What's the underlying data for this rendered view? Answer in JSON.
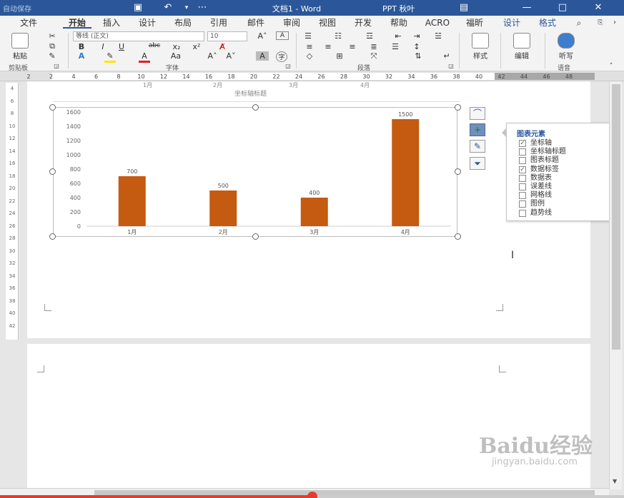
{
  "titlebar": {
    "autosave": "自动保存",
    "doc_title": "文档1  -  Word",
    "ppt_label": "PPT 秋叶",
    "buttons": {
      "minimize": "—",
      "restore": "□",
      "close": "✕"
    },
    "icons": {
      "save": "save-icon",
      "undo": "undo-icon",
      "customize": "customize-qat-icon"
    }
  },
  "tabs": [
    {
      "label": "文件"
    },
    {
      "label": "开始"
    },
    {
      "label": "插入"
    },
    {
      "label": "设计"
    },
    {
      "label": "布局"
    },
    {
      "label": "引用"
    },
    {
      "label": "邮件"
    },
    {
      "label": "审阅"
    },
    {
      "label": "视图"
    },
    {
      "label": "开发"
    },
    {
      "label": "帮助"
    },
    {
      "label": "ACRO"
    },
    {
      "label": "福昕"
    },
    {
      "label": "设计"
    },
    {
      "label": "格式"
    }
  ],
  "active_tab": "开始",
  "ribbon": {
    "paste_label": "粘贴",
    "clipboard_group": "剪贴板",
    "font_name": "等线 (正文)",
    "font_size": "10",
    "font_group": "字体",
    "paragraph_group": "段落",
    "styles_label": "样式",
    "editing_label": "编辑",
    "dictate_label": "听写",
    "voice_group": "语音",
    "format_buttons": {
      "bold": "B",
      "italic": "I",
      "underline": "U",
      "strike": "abc",
      "subscript": "x₂",
      "superscript": "x²",
      "aa": "Aa",
      "grow": "A˄",
      "shrink": "A˅"
    }
  },
  "ruler": {
    "numbers": [
      "2",
      "2",
      "4",
      "6",
      "8",
      "10",
      "12",
      "14",
      "16",
      "18",
      "20",
      "22",
      "24",
      "26",
      "28",
      "30",
      "32",
      "34",
      "36",
      "38",
      "40",
      "42",
      "44",
      "46",
      "48"
    ]
  },
  "vertical_ruler": {
    "marks": [
      "4",
      "6",
      "8",
      "10",
      "12",
      "14",
      "16",
      "18",
      "20",
      "22",
      "24",
      "26",
      "28",
      "30",
      "32",
      "34",
      "36",
      "38",
      "40",
      "42"
    ]
  },
  "previous_chart": {
    "tick_labels": [
      "1月",
      "2月",
      "3月",
      "4月"
    ],
    "axis_title": "坐标轴标题"
  },
  "chart_data": {
    "type": "bar",
    "categories": [
      "1月",
      "2月",
      "3月",
      "4月"
    ],
    "values": [
      700,
      500,
      400,
      1500
    ],
    "data_labels": [
      "700",
      "500",
      "400",
      "1500"
    ],
    "y_ticks": [
      "0",
      "200",
      "400",
      "600",
      "800",
      "1000",
      "1200",
      "1400",
      "1600"
    ],
    "ylim": [
      0,
      1600
    ],
    "title": "",
    "xlabel": "",
    "ylabel": "",
    "grid": false,
    "bar_color": "#c55a11"
  },
  "chart_tools": {
    "layout_icon": "chart-layout-icon",
    "elements_icon": "plus-icon",
    "styles_icon": "brush-icon",
    "filter_icon": "filter-icon"
  },
  "chart_elements_panel": {
    "title": "图表元素",
    "items": [
      {
        "label": "坐标轴",
        "checked": true
      },
      {
        "label": "坐标轴标题",
        "checked": false
      },
      {
        "label": "图表标题",
        "checked": false
      },
      {
        "label": "数据标签",
        "checked": true
      },
      {
        "label": "数据表",
        "checked": false
      },
      {
        "label": "误差线",
        "checked": false
      },
      {
        "label": "网格线",
        "checked": false
      },
      {
        "label": "图例",
        "checked": false
      },
      {
        "label": "趋势线",
        "checked": false
      }
    ]
  },
  "watermark": {
    "brand": "Baidu经验",
    "url": "jingyan.baidu.com"
  },
  "video_progress": 0.5,
  "colors": {
    "title_bar": "#2b579a",
    "accent": "#2b579a",
    "bar": "#c55a11",
    "progress": "#e53b2c"
  }
}
